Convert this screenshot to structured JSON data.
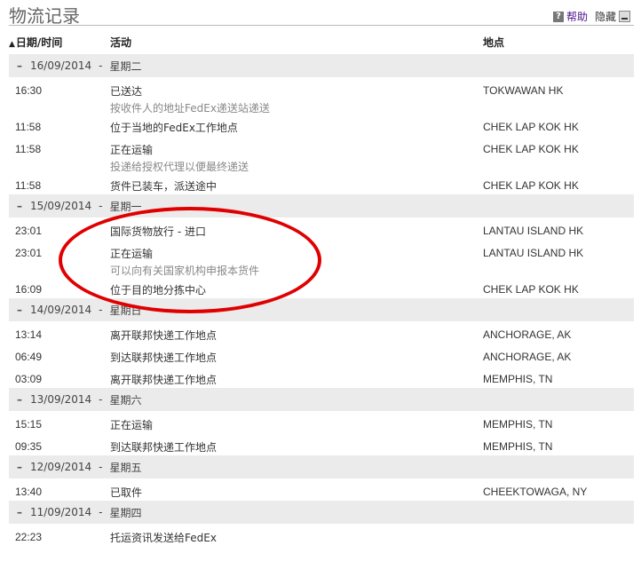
{
  "page": {
    "title": "物流记录",
    "help_label": "帮助",
    "hide_label": "隐藏",
    "help_icon": "?",
    "sort_icon": "▲"
  },
  "columns": {
    "datetime": "日期/时间",
    "activity": "活动",
    "location": "地点"
  },
  "groups": [
    {
      "date": "16/09/2014",
      "weekday": "星期二",
      "events": [
        {
          "time": "16:30",
          "activity": "已送达",
          "detail": "按收件人的地址FedEx递送站递送",
          "location": "TOKWAWAN HK"
        },
        {
          "time": "11:58",
          "activity": "位于当地的FedEx工作地点",
          "detail": "",
          "location": "CHEK LAP KOK HK"
        },
        {
          "time": "11:58",
          "activity": "正在运输",
          "detail": "投递给授权代理以便最终递送",
          "location": "CHEK LAP KOK HK"
        },
        {
          "time": "11:58",
          "activity": "货件已装车，派送途中",
          "detail": "",
          "location": "CHEK LAP KOK HK"
        }
      ]
    },
    {
      "date": "15/09/2014",
      "weekday": "星期一",
      "events": [
        {
          "time": "23:01",
          "activity": "国际货物放行 - 进口",
          "detail": "",
          "location": "LANTAU ISLAND HK"
        },
        {
          "time": "23:01",
          "activity": "正在运输",
          "detail": "可以向有关国家机构申报本货件",
          "location": "LANTAU ISLAND HK"
        },
        {
          "time": "16:09",
          "activity": "位于目的地分拣中心",
          "detail": "",
          "location": "CHEK LAP KOK HK"
        }
      ]
    },
    {
      "date": "14/09/2014",
      "weekday": "星期日",
      "events": [
        {
          "time": "13:14",
          "activity": "离开联邦快递工作地点",
          "detail": "",
          "location": "ANCHORAGE, AK"
        },
        {
          "time": "06:49",
          "activity": "到达联邦快递工作地点",
          "detail": "",
          "location": "ANCHORAGE, AK"
        },
        {
          "time": "03:09",
          "activity": "离开联邦快递工作地点",
          "detail": "",
          "location": "MEMPHIS, TN"
        }
      ]
    },
    {
      "date": "13/09/2014",
      "weekday": "星期六",
      "events": [
        {
          "time": "15:15",
          "activity": "正在运输",
          "detail": "",
          "location": "MEMPHIS, TN"
        },
        {
          "time": "09:35",
          "activity": "到达联邦快递工作地点",
          "detail": "",
          "location": "MEMPHIS, TN"
        }
      ]
    },
    {
      "date": "12/09/2014",
      "weekday": "星期五",
      "events": [
        {
          "time": "13:40",
          "activity": "已取件",
          "detail": "",
          "location": "CHEEKTOWAGA, NY"
        }
      ]
    },
    {
      "date": "11/09/2014",
      "weekday": "星期四",
      "events": [
        {
          "time": "22:23",
          "activity": "托运资讯发送给FedEx",
          "detail": "",
          "location": ""
        }
      ]
    }
  ],
  "toggle_symbol": "–",
  "annotation_color": "#e00000"
}
